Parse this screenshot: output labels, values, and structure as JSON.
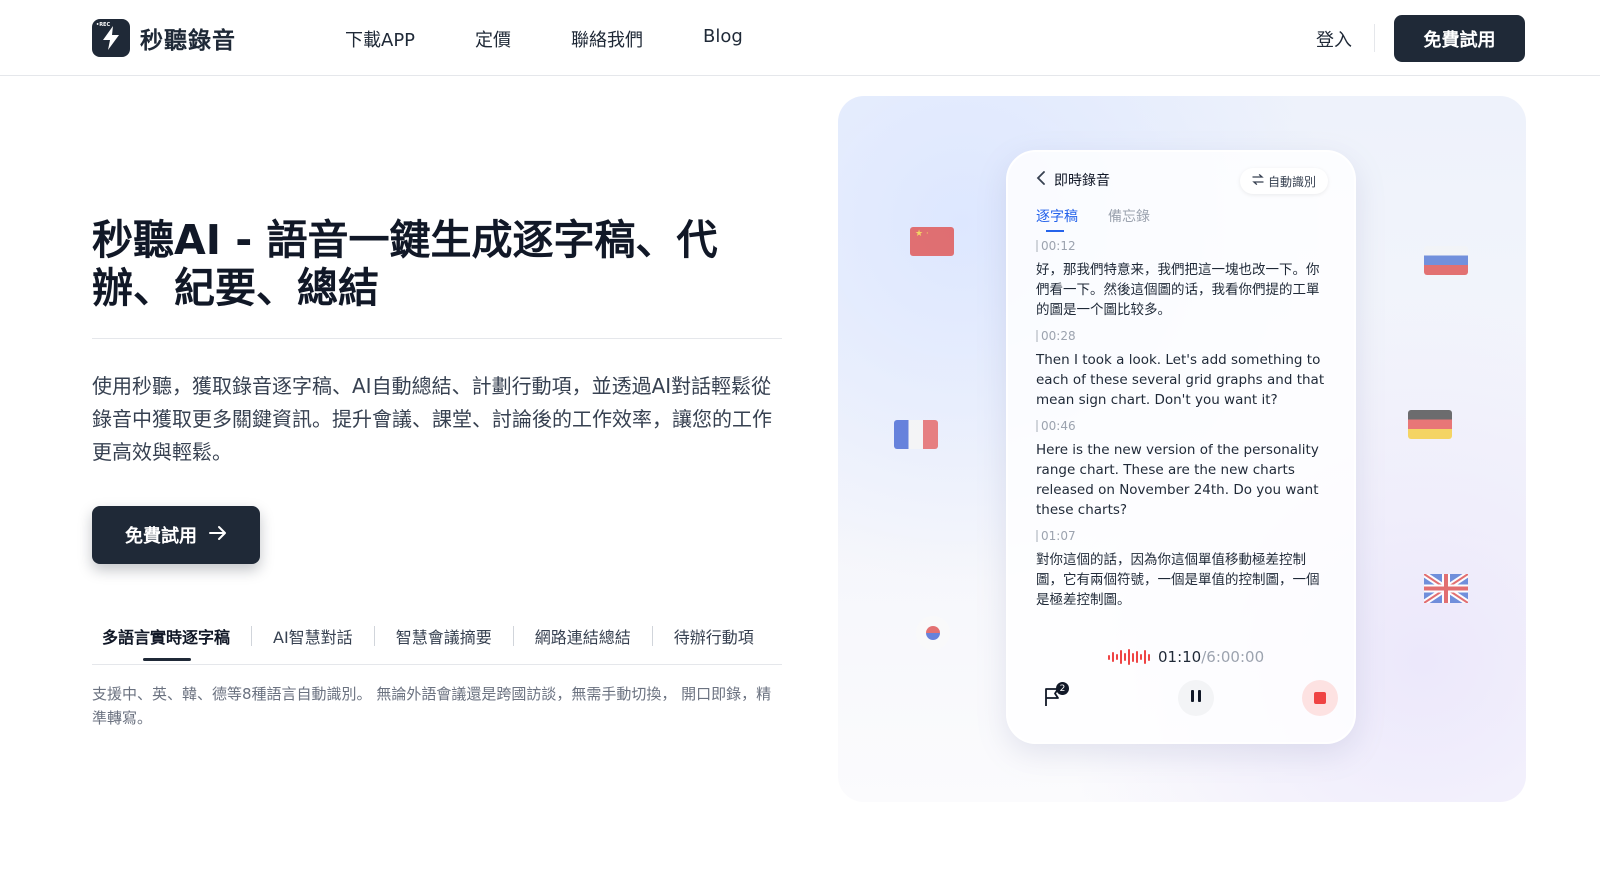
{
  "header": {
    "brand": "秒聽錄音",
    "logo_badge": "•REC",
    "nav": [
      "下載APP",
      "定價",
      "聯絡我們",
      "Blog"
    ],
    "login": "登入",
    "cta": "免費試用"
  },
  "hero": {
    "title": "秒聽AI - 語音一鍵生成逐字稿、代辦、紀要、總結",
    "description": "使用秒聽，獲取錄音逐字稿、AI自動總結、計劃行動項，並透過AI對話輕鬆從錄音中獲取更多關鍵資訊。提升會議、課堂、討論後的工作效率，讓您的工作更高效與輕鬆。",
    "cta": "免費試用",
    "features": [
      "多語言實時逐字稿",
      "AI智慧對話",
      "智慧會議摘要",
      "網路連結總結",
      "待辦行動項"
    ],
    "active_feature": 0,
    "feature_description": "支援中、英、韓、德等8種語言自動識別。 無論外語會議還是跨國訪談，無需手動切換， 開口即錄，精準轉寫。"
  },
  "phone": {
    "title": "即時錄音",
    "auto_detect": "自動識別",
    "tabs": [
      "逐字稿",
      "備忘錄"
    ],
    "segments": [
      {
        "time": "00:12",
        "text": "好，那我們特意来，我們把這一塊也改一下。你們看一下。然後這個圖的话，我看你們提的工單的圖是一个圖比较多。"
      },
      {
        "time": "00:28",
        "text": "Then I took a look. Let's add something to each of these several grid graphs and that mean sign chart. Don't you want it?"
      },
      {
        "time": "00:46",
        "text": "Here is the new version of the personality range chart. These are the new charts released on November 24th. Do you want these charts?"
      },
      {
        "time": "01:07",
        "text": "對你這個的話，因為你這個單值移動極差控制圖，它有兩個符號，一個是單值的控制圖，一個是極差控制圖。"
      }
    ],
    "elapsed": "01:10",
    "total": "/6:00:00",
    "flag_count": "2",
    "accent_color": "#ef4444"
  }
}
